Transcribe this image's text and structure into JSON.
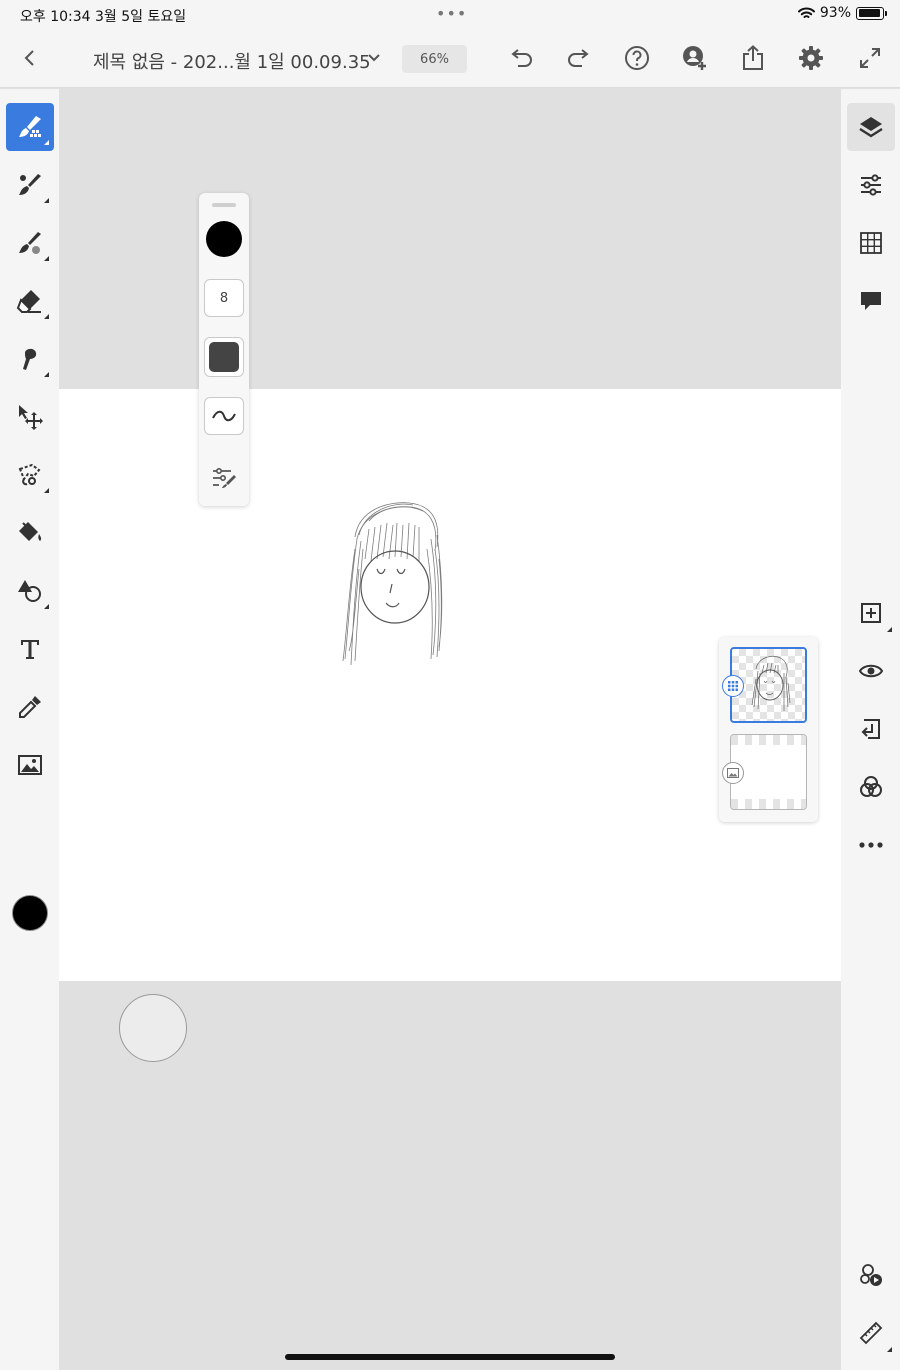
{
  "status_bar": {
    "time_date": "오후 10:34   3월 5일 토요일",
    "dots": "•••",
    "battery": "93%"
  },
  "header": {
    "title": "제목 없음 - 202...월 1일 00.09.35",
    "zoom": "66%"
  },
  "left_toolbar": {
    "tools": [
      {
        "name": "pixel-brush",
        "active": true
      },
      {
        "name": "live-brush"
      },
      {
        "name": "mixer-brush"
      },
      {
        "name": "eraser"
      },
      {
        "name": "smudge"
      },
      {
        "name": "move"
      },
      {
        "name": "lasso"
      },
      {
        "name": "fill"
      },
      {
        "name": "shapes"
      },
      {
        "name": "text"
      },
      {
        "name": "eyedropper"
      },
      {
        "name": "image"
      }
    ],
    "current_color": "#000000"
  },
  "brush_panel": {
    "color": "#000000",
    "size": "8"
  },
  "right_toolbar": {
    "tools": [
      "layers",
      "layer-properties",
      "grid",
      "comments",
      "add-layer",
      "visibility",
      "merge-down",
      "blend",
      "more",
      "timelapse",
      "ruler"
    ]
  },
  "colors": {
    "accent": "#3a7be0",
    "toolbar_bg": "#f5f5f5",
    "workspace_bg": "#e0e0e0",
    "canvas_bg": "#ffffff"
  }
}
